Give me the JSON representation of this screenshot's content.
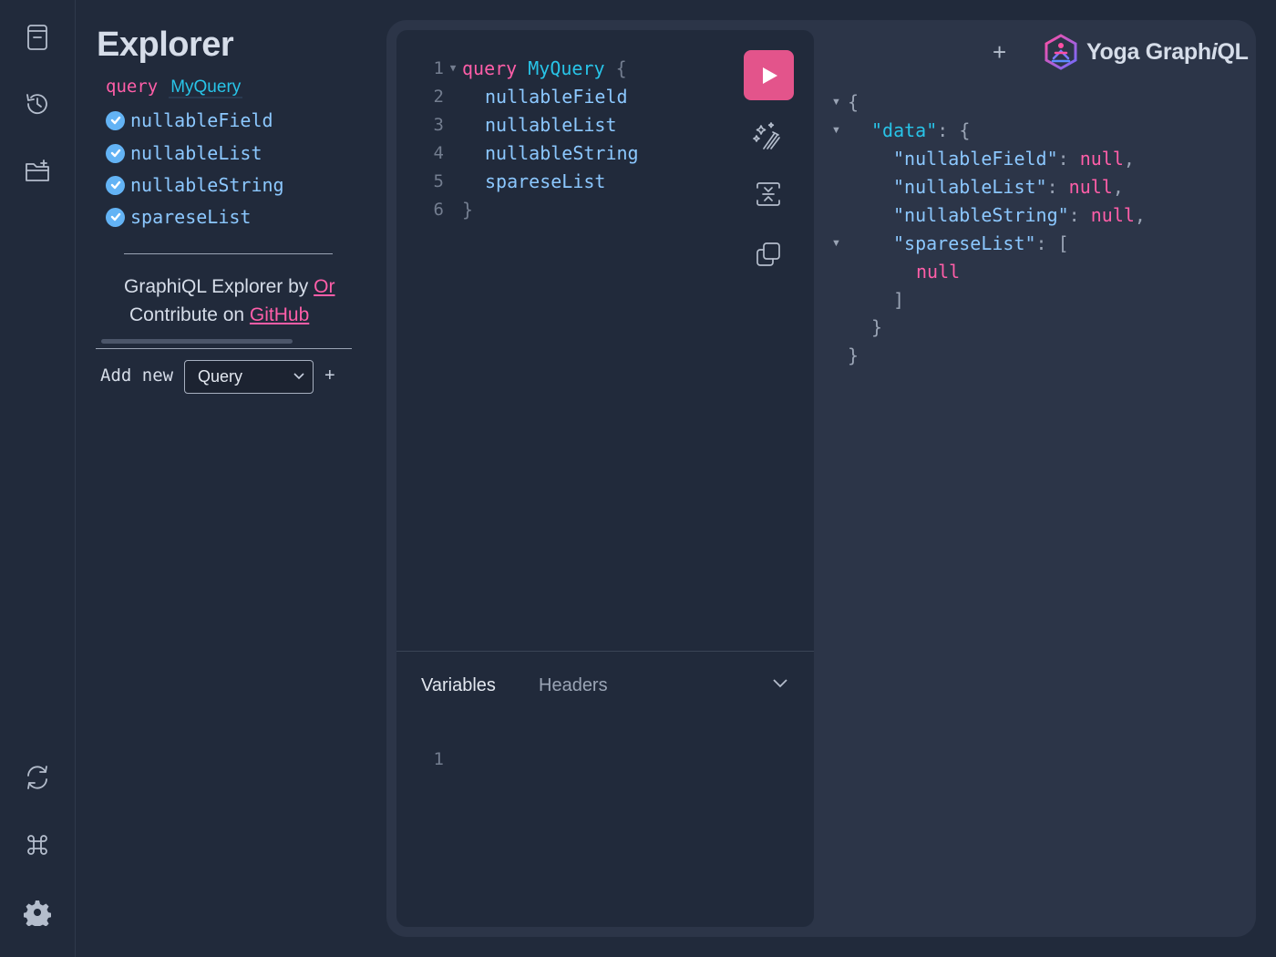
{
  "sidebar": {
    "icons": [
      "docs-icon",
      "history-icon",
      "folder-plus-icon",
      "refresh-icon",
      "command-icon",
      "settings-icon"
    ]
  },
  "explorer": {
    "title": "Explorer",
    "operation_keyword": "query",
    "operation_name": "MyQuery",
    "fields": [
      "nullableField",
      "nullableList",
      "nullableString",
      "spareseList"
    ],
    "credit_line1_prefix": "GraphiQL Explorer by ",
    "credit_line1_link": "Or",
    "credit_line2_prefix": "Contribute on ",
    "credit_line2_link": "GitHub",
    "add_new_label": "Add new",
    "add_new_selected": "Query",
    "add_button": "+"
  },
  "editor": {
    "line_numbers": [
      "1",
      "2",
      "3",
      "4",
      "5",
      "6"
    ],
    "query_keyword": "query",
    "query_name": "MyQuery",
    "open_brace": "{",
    "close_brace": "}",
    "fields": [
      "nullableField",
      "nullableList",
      "nullableString",
      "spareseList"
    ],
    "tabs": {
      "variables": "Variables",
      "headers": "Headers"
    },
    "variables_line_number": "1"
  },
  "header": {
    "new_tab": "+",
    "brand_prefix": "Yoga Graph",
    "brand_italic": "i",
    "brand_suffix": "QL"
  },
  "response": {
    "data_key": "\"data\"",
    "entries": [
      {
        "key": "\"nullableField\"",
        "value": "null"
      },
      {
        "key": "\"nullableList\"",
        "value": "null"
      },
      {
        "key": "\"nullableString\"",
        "value": "null"
      }
    ],
    "list_key": "\"spareseList\"",
    "list_item": "null"
  },
  "colors": {
    "background": "#212a3b",
    "panel": "#2c3548",
    "accent_pink": "#e3548b",
    "keyword": "#ff5ea8",
    "field": "#8cc8ff",
    "cyan": "#28c4e8"
  }
}
